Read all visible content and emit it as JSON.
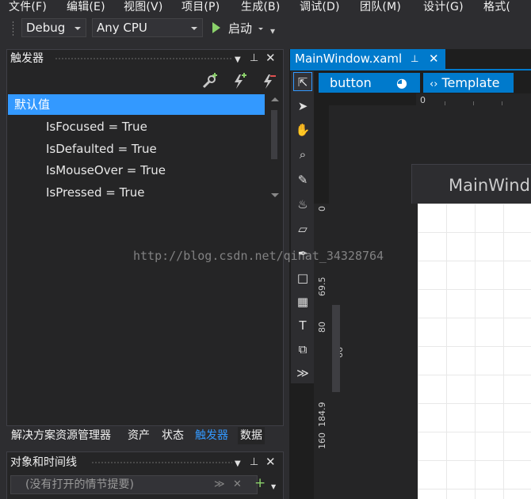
{
  "menu": [
    "文件(F)",
    "编辑(E)",
    "视图(V)",
    "项目(P)",
    "生成(B)",
    "调试(D)",
    "团队(M)",
    "设计(G)",
    "格式("
  ],
  "toolbar": {
    "configuration": "Debug",
    "platform": "Any CPU",
    "start_label": "启动",
    "play_icon": "play-icon"
  },
  "triggers_panel": {
    "title": "触发器",
    "default_item": "默认值",
    "conditions": [
      "IsFocused = True",
      "IsDefaulted = True",
      "IsMouseOver = True",
      "IsPressed = True"
    ],
    "icons": [
      "add-property-trigger-icon",
      "add-event-trigger-icon",
      "remove-trigger-icon"
    ]
  },
  "bottom_tabs": [
    "解决方案资源管理器",
    "资产",
    "状态",
    "触发器",
    "数据"
  ],
  "active_bottom_tab": "触发器",
  "timeline_panel": {
    "title": "对象和时间线",
    "storyboard_placeholder": "(没有打开的情节提要)"
  },
  "document": {
    "tab_title": "MainWindow.xaml",
    "breadcrumb": [
      "button",
      "Template"
    ],
    "window_title": "MainWind",
    "ruler_h": "0",
    "ruler_v": [
      "0",
      "69.5",
      "80",
      "66",
      "184.9",
      "160"
    ]
  },
  "watermark": "http://blog.csdn.net/qinat_34328764",
  "colors": {
    "accent": "#007acc",
    "selection": "#3399ff",
    "background": "#2d2d30",
    "panel": "#252526"
  }
}
